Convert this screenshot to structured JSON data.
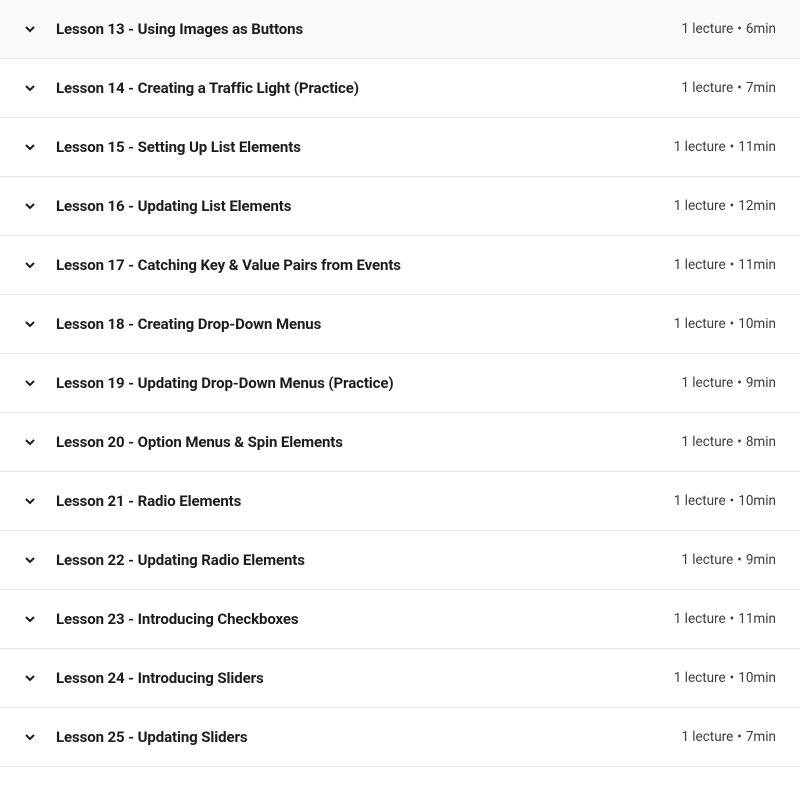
{
  "lessons": [
    {
      "title": "Lesson 13 - Using Images as Buttons",
      "lectures": "1 lecture",
      "duration": "6min"
    },
    {
      "title": "Lesson 14 - Creating a Traffic Light (Practice)",
      "lectures": "1 lecture",
      "duration": "7min"
    },
    {
      "title": "Lesson 15 - Setting Up List Elements",
      "lectures": "1 lecture",
      "duration": "11min"
    },
    {
      "title": "Lesson 16 - Updating List Elements",
      "lectures": "1 lecture",
      "duration": "12min"
    },
    {
      "title": "Lesson 17 - Catching Key & Value Pairs from Events",
      "lectures": "1 lecture",
      "duration": "11min"
    },
    {
      "title": "Lesson 18 - Creating Drop-Down Menus",
      "lectures": "1 lecture",
      "duration": "10min"
    },
    {
      "title": "Lesson 19 - Updating Drop-Down Menus (Practice)",
      "lectures": "1 lecture",
      "duration": "9min"
    },
    {
      "title": "Lesson 20 - Option Menus & Spin Elements",
      "lectures": "1 lecture",
      "duration": "8min"
    },
    {
      "title": "Lesson 21 - Radio Elements",
      "lectures": "1 lecture",
      "duration": "10min"
    },
    {
      "title": "Lesson 22 - Updating Radio Elements",
      "lectures": "1 lecture",
      "duration": "9min"
    },
    {
      "title": "Lesson 23 - Introducing Checkboxes",
      "lectures": "1 lecture",
      "duration": "11min"
    },
    {
      "title": "Lesson 24 - Introducing Sliders",
      "lectures": "1 lecture",
      "duration": "10min"
    },
    {
      "title": "Lesson 25 - Updating Sliders",
      "lectures": "1 lecture",
      "duration": "7min"
    }
  ],
  "separator": "•"
}
